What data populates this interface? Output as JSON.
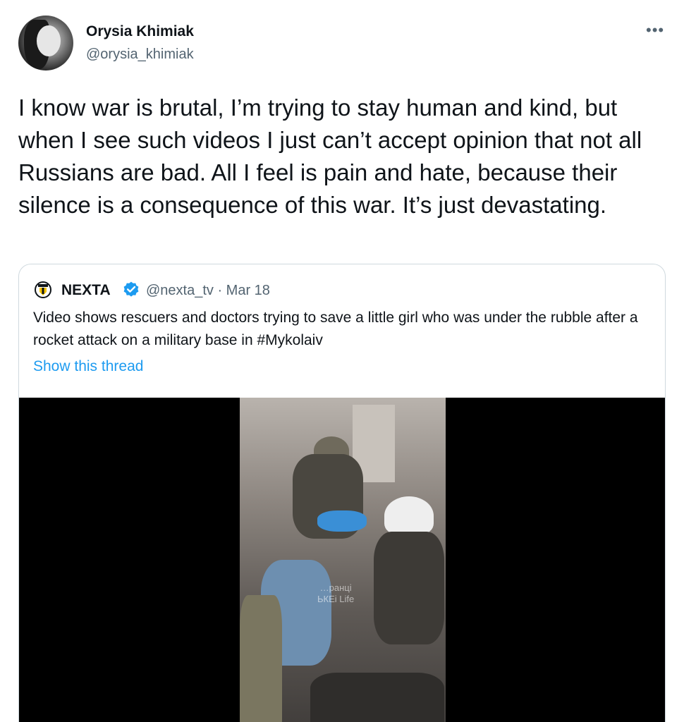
{
  "author": {
    "name": "Orysia Khimiak",
    "handle": "@orysia_khimiak"
  },
  "more_icon": "•••",
  "tweet_text": "I know war is brutal, I’m trying to stay human and kind, but when I see such videos I just can’t accept opinion that not all Russians are bad. All I feel is pain and hate, because their silence is a consequence of this war. It’s just devastating.",
  "quoted": {
    "name": "NEXTA",
    "handle_date": "@nexta_tv · Mar 18",
    "text": "Video shows rescuers and doctors trying to save a little girl who was under the rubble after a rocket attack on a military base in #Mykolaiv",
    "link": "Show this thread",
    "verified_icon": "verified-badge-icon",
    "logo_icon": "nexta-logo-icon",
    "video_watermark": "…ранці\nЬКЕі Life"
  },
  "colors": {
    "link": "#1d9bf0",
    "secondary_text": "#536471",
    "border": "#cfd9de",
    "verified": "#1d9bf0"
  }
}
